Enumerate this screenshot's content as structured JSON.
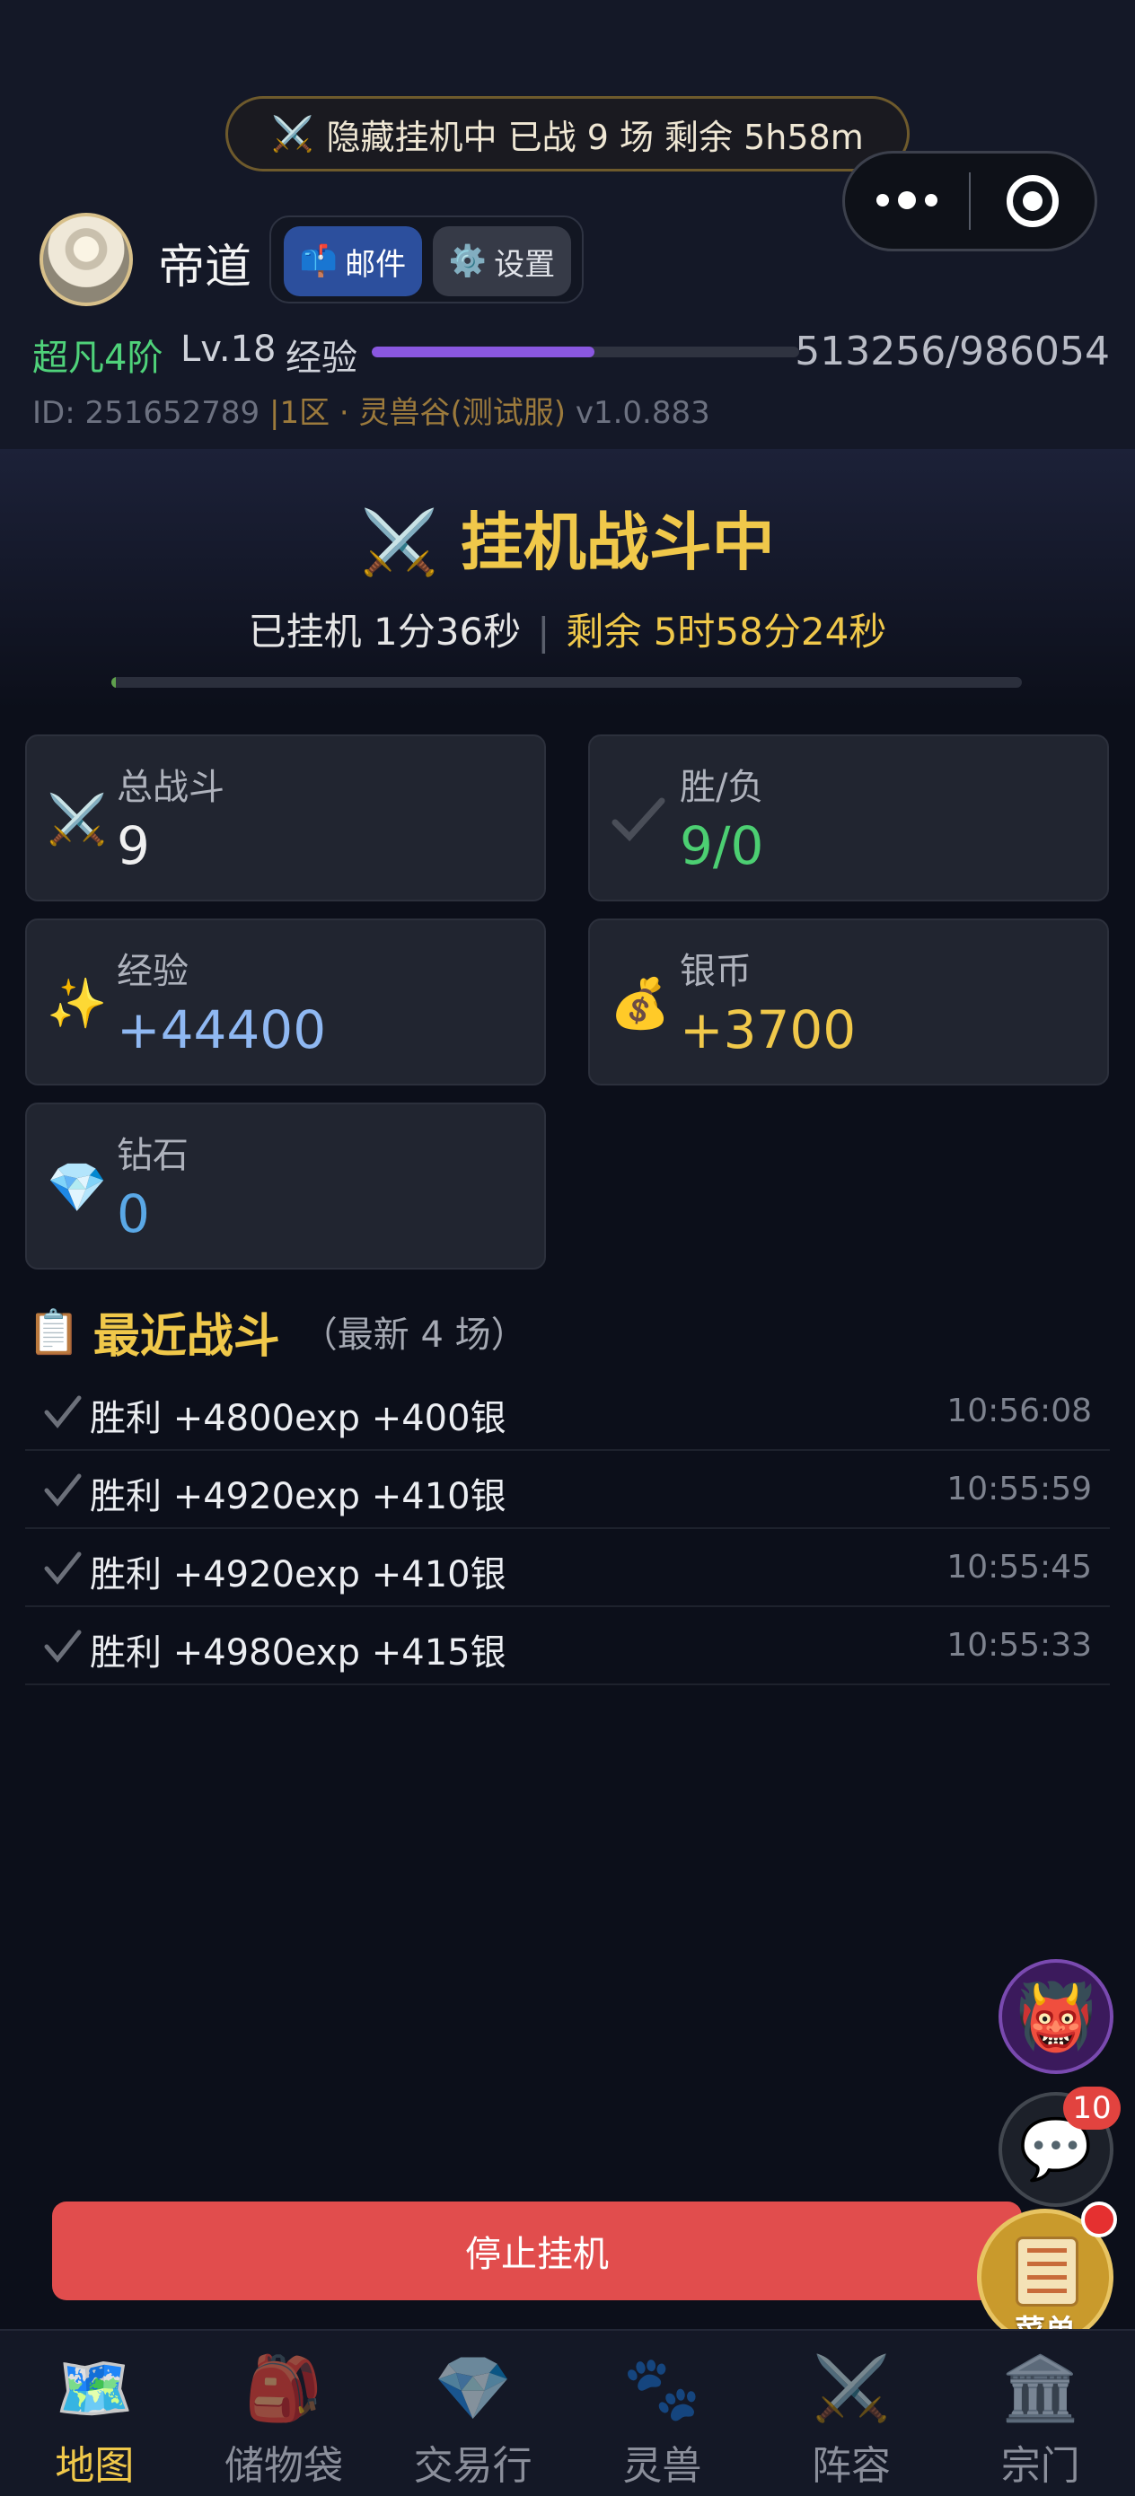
{
  "status_pill": {
    "icon": "crossed-swords",
    "text": "隐藏挂机中  已战 9 场  剩余 5h58m"
  },
  "player": {
    "name": "帝道",
    "mail_label": "邮件",
    "settings_label": "设置",
    "realm": "超凡4阶",
    "level": "Lv.18",
    "exp_label": "经验",
    "exp_value": "513256/986054",
    "exp_fraction": 0.5205,
    "id_text": "ID: 251652789",
    "server_text": "|1区 · 灵兽谷(测试服)",
    "version": "v1.0.883"
  },
  "hero": {
    "title": "挂机战斗中",
    "elapsed": "已挂机 1分36秒",
    "separator": "|",
    "remaining": "剩余 5时58分24秒",
    "progress_fraction": 0.0045
  },
  "stats": [
    {
      "label": "总战斗",
      "value": "9",
      "icon": "crossed-swords",
      "color": "#f0f0f0"
    },
    {
      "label": "胜/负",
      "value": "9/0",
      "icon": "check",
      "color": "#4ccf72"
    },
    {
      "label": "经验",
      "value": "+44400",
      "icon": "sparkles",
      "color": "#8fb8f2"
    },
    {
      "label": "银币",
      "value": "+3700",
      "icon": "money-bag",
      "color": "#f0c84a"
    },
    {
      "label": "钻石",
      "value": "0",
      "icon": "diamond",
      "color": "#5aa8e6"
    }
  ],
  "recent": {
    "title": "最近战斗",
    "count": "（最新 4 场）",
    "battles": [
      {
        "text": "胜利 +4800exp +400银",
        "time": "10:56:08"
      },
      {
        "text": "胜利 +4920exp +410银",
        "time": "10:55:59"
      },
      {
        "text": "胜利 +4920exp +410银",
        "time": "10:55:45"
      },
      {
        "text": "胜利 +4980exp +415银",
        "time": "10:55:33"
      }
    ]
  },
  "chat_badge": "10",
  "stop_button": "停止挂机",
  "menu_label": "菜单",
  "tabs": [
    {
      "label": "地图",
      "icon": "map-icon",
      "active": true
    },
    {
      "label": "储物袋",
      "icon": "backpack-icon",
      "active": false
    },
    {
      "label": "交易行",
      "icon": "gem-icon",
      "active": false
    },
    {
      "label": "灵兽",
      "icon": "paw-icon",
      "active": false
    },
    {
      "label": "阵容",
      "icon": "swords-icon",
      "active": false
    },
    {
      "label": "宗门",
      "icon": "temple-icon",
      "active": false
    }
  ]
}
